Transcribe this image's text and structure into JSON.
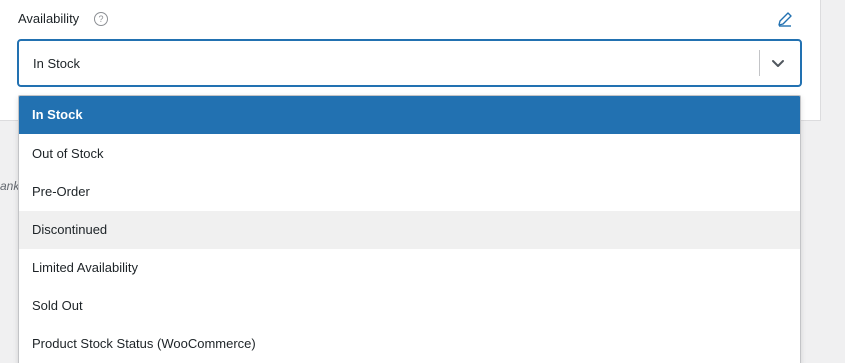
{
  "field": {
    "label": "Availability",
    "help_glyph": "?",
    "help_icon": "question-circle-icon",
    "edit_icon": "pencil-icon"
  },
  "select": {
    "value": "In Stock",
    "chevron_icon": "chevron-down-icon"
  },
  "side_text": "ank",
  "options": [
    {
      "label": "In Stock",
      "state": "selected"
    },
    {
      "label": "Out of Stock",
      "state": "normal"
    },
    {
      "label": "Pre-Order",
      "state": "normal"
    },
    {
      "label": "Discontinued",
      "state": "hovered"
    },
    {
      "label": "Limited Availability",
      "state": "normal"
    },
    {
      "label": "Sold Out",
      "state": "normal"
    },
    {
      "label": "Product Stock Status (WooCommerce)",
      "state": "normal"
    }
  ],
  "colors": {
    "accent": "#2271b1",
    "hover_bg": "#f0f0f0",
    "page_bg": "#f0f0f1"
  }
}
